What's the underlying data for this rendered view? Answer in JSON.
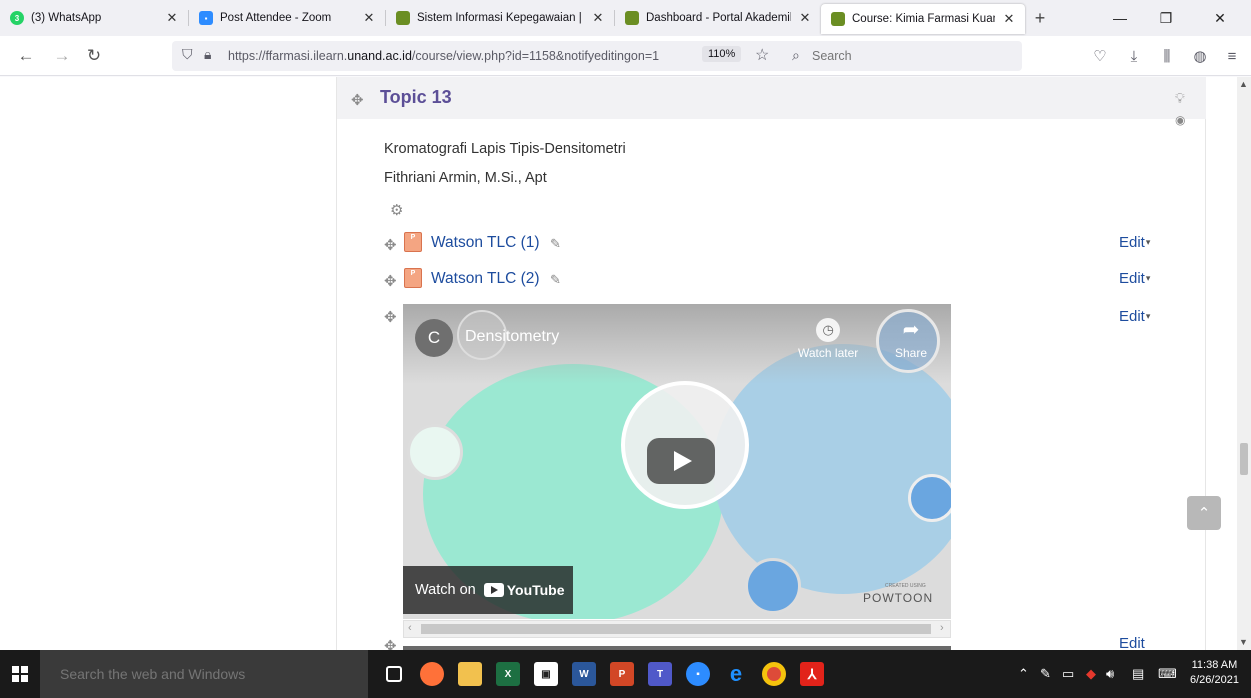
{
  "browser": {
    "tabs": [
      {
        "title": "(3) WhatsApp",
        "icon": "whatsapp-icon",
        "color": "#25d366",
        "active": false
      },
      {
        "title": "Post Attendee - Zoom",
        "icon": "zoom-icon",
        "color": "#2d8cff",
        "active": false
      },
      {
        "title": "Sistem Informasi Kepegawaian |",
        "icon": "unand-icon",
        "color": "#6b8e23",
        "active": false
      },
      {
        "title": "Dashboard - Portal Akademik U",
        "icon": "unand-icon",
        "color": "#6b8e23",
        "active": false
      },
      {
        "title": "Course: Kimia Farmasi Kuantita",
        "icon": "unand-icon",
        "color": "#6b8e23",
        "active": true
      }
    ],
    "whatsapp_badge": "3",
    "url_prefix": "https://ffarmasi.ilearn.",
    "url_host": "unand.ac.id",
    "url_path": "/course/view.php?id=1158&notifyeditingon=1",
    "zoom": "110%",
    "search_placeholder": "Search"
  },
  "course": {
    "topic_title": "Topic 13",
    "summary_line1": "Kromatografi Lapis Tipis-Densitometri",
    "summary_line2": "Fithriani Armin, M.Si., Apt",
    "activities": [
      {
        "name": "Watson TLC (1)",
        "edit": "Edit"
      },
      {
        "name": "Watson TLC (2)",
        "edit": "Edit"
      }
    ],
    "video_edit": "Edit",
    "video": {
      "channel_initial": "C",
      "title": "Densitometry",
      "watch_later": "Watch later",
      "share": "Share",
      "watch_on": "Watch on",
      "youtube": "YouTube",
      "created_using": "CREATED USING",
      "powtoon": "POWTOON"
    },
    "next_edit": "Edit"
  },
  "taskbar": {
    "search_placeholder": "Search the web and Windows",
    "time": "11:38 AM",
    "date": "6/26/2021"
  },
  "colors": {
    "topic_title": "#5c4f97",
    "link": "#1d4c9e",
    "video_green": "#9be8d2",
    "video_blue": "#a9cfe6"
  }
}
